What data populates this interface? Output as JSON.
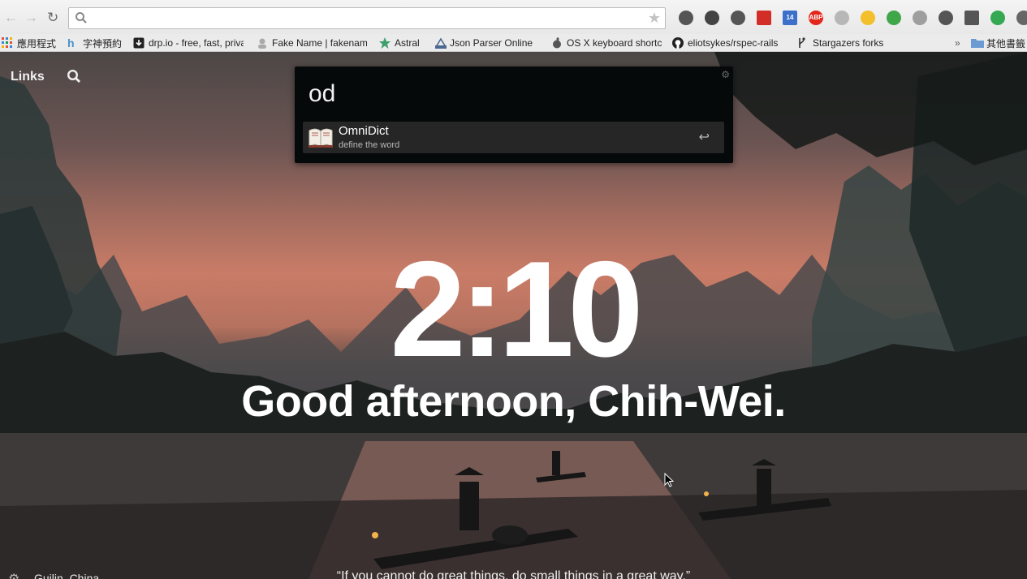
{
  "browser": {
    "back_glyph": "←",
    "forward_glyph": "→",
    "reload_glyph": "↻",
    "address_value": "",
    "bookmark_star": "★",
    "extensions": [
      {
        "name": "ghostery-icon",
        "color": "#555555"
      },
      {
        "name": "pocket-icon",
        "color": "#444444"
      },
      {
        "name": "evernote-icon",
        "color": "#555555"
      },
      {
        "name": "lastpass-icon",
        "color": "#d32d27"
      },
      {
        "name": "calendar-icon",
        "badge": "14",
        "color": "#3b6fc9"
      },
      {
        "name": "adblock-icon",
        "badge": "ABP",
        "color": "#e3261c"
      },
      {
        "name": "circle-icon",
        "color": "#b7b7b7"
      },
      {
        "name": "buffer-icon",
        "color": "#f3c02c"
      },
      {
        "name": "leaf-icon",
        "color": "#3fa64a"
      },
      {
        "name": "todo-icon",
        "color": "#9e9e9e"
      },
      {
        "name": "copy-icon",
        "color": "#555555"
      },
      {
        "name": "mail-icon",
        "color": "#555555"
      },
      {
        "name": "check-icon",
        "color": "#34a853"
      },
      {
        "name": "menu-icon",
        "color": "#666666"
      }
    ],
    "bookmarks": [
      {
        "label": "應用程式",
        "fav": "#e44d3a"
      },
      {
        "label": "字神預約",
        "fav": "#4a90c8"
      },
      {
        "label": "drp.io - free, fast, private",
        "fav": "#222222"
      },
      {
        "label": "Fake Name | fakenamegenerator",
        "fav": "#8e8e8e"
      },
      {
        "label": "Astral",
        "fav": "#3d9f6a"
      },
      {
        "label": "Json Parser Online",
        "fav": "#4a6890"
      },
      {
        "label": "OS X keyboard shortcuts",
        "fav": "#555555"
      },
      {
        "label": "eliotsykes/rspec-rails",
        "fav": "#222222"
      },
      {
        "label": "Stargazers forks",
        "fav": "#333333"
      }
    ],
    "more_glyph": "»",
    "other_bookmarks": "其他書籤"
  },
  "dashboard": {
    "links_label": "Links",
    "time": "2:10",
    "greeting": "Good afternoon, Chih-Wei.",
    "location": "Guilin, China",
    "quote": "“If you cannot do great things, do small things in a great way.”"
  },
  "launcher": {
    "query": "od",
    "settings_glyph": "⚙",
    "results": [
      {
        "title": "OmniDict",
        "subtitle": "define the word",
        "enter_glyph": "↩"
      }
    ]
  }
}
